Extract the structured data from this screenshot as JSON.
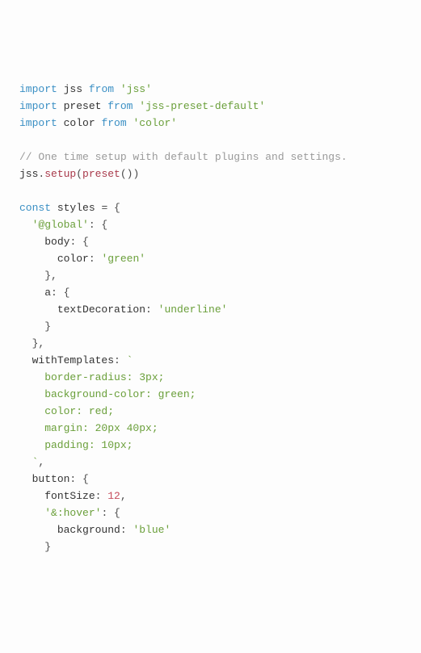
{
  "lines": [
    {
      "t": [
        {
          "c": "kw",
          "v": "import"
        },
        {
          "c": "pun",
          "v": " "
        },
        {
          "c": "id",
          "v": "jss"
        },
        {
          "c": "pun",
          "v": " "
        },
        {
          "c": "kw",
          "v": "from"
        },
        {
          "c": "pun",
          "v": " "
        },
        {
          "c": "str",
          "v": "'jss'"
        }
      ]
    },
    {
      "t": [
        {
          "c": "kw",
          "v": "import"
        },
        {
          "c": "pun",
          "v": " "
        },
        {
          "c": "id",
          "v": "preset"
        },
        {
          "c": "pun",
          "v": " "
        },
        {
          "c": "kw",
          "v": "from"
        },
        {
          "c": "pun",
          "v": " "
        },
        {
          "c": "str",
          "v": "'jss-preset-default'"
        }
      ]
    },
    {
      "t": [
        {
          "c": "kw",
          "v": "import"
        },
        {
          "c": "pun",
          "v": " "
        },
        {
          "c": "id",
          "v": "color"
        },
        {
          "c": "pun",
          "v": " "
        },
        {
          "c": "kw",
          "v": "from"
        },
        {
          "c": "pun",
          "v": " "
        },
        {
          "c": "str",
          "v": "'color'"
        }
      ]
    },
    {
      "t": [
        {
          "c": "pun",
          "v": ""
        }
      ]
    },
    {
      "t": [
        {
          "c": "cmt",
          "v": "// One time setup with default plugins and settings."
        }
      ]
    },
    {
      "t": [
        {
          "c": "id",
          "v": "jss"
        },
        {
          "c": "pun",
          "v": "."
        },
        {
          "c": "call",
          "v": "setup"
        },
        {
          "c": "pun",
          "v": "("
        },
        {
          "c": "call",
          "v": "preset"
        },
        {
          "c": "pun",
          "v": "())"
        }
      ]
    },
    {
      "t": [
        {
          "c": "pun",
          "v": ""
        }
      ]
    },
    {
      "t": [
        {
          "c": "kw",
          "v": "const"
        },
        {
          "c": "pun",
          "v": " "
        },
        {
          "c": "id",
          "v": "styles"
        },
        {
          "c": "pun",
          "v": " = {"
        }
      ]
    },
    {
      "t": [
        {
          "c": "pun",
          "v": "  "
        },
        {
          "c": "str",
          "v": "'@global'"
        },
        {
          "c": "pun",
          "v": ": {"
        }
      ]
    },
    {
      "t": [
        {
          "c": "pun",
          "v": "    "
        },
        {
          "c": "key",
          "v": "body"
        },
        {
          "c": "pun",
          "v": ": {"
        }
      ]
    },
    {
      "t": [
        {
          "c": "pun",
          "v": "      "
        },
        {
          "c": "key",
          "v": "color"
        },
        {
          "c": "pun",
          "v": ": "
        },
        {
          "c": "str",
          "v": "'green'"
        }
      ]
    },
    {
      "t": [
        {
          "c": "pun",
          "v": "    },"
        }
      ]
    },
    {
      "t": [
        {
          "c": "pun",
          "v": "    "
        },
        {
          "c": "key",
          "v": "a"
        },
        {
          "c": "pun",
          "v": ": {"
        }
      ]
    },
    {
      "t": [
        {
          "c": "pun",
          "v": "      "
        },
        {
          "c": "key",
          "v": "textDecoration"
        },
        {
          "c": "pun",
          "v": ": "
        },
        {
          "c": "str",
          "v": "'underline'"
        }
      ]
    },
    {
      "t": [
        {
          "c": "pun",
          "v": "    }"
        }
      ]
    },
    {
      "t": [
        {
          "c": "pun",
          "v": "  },"
        }
      ]
    },
    {
      "t": [
        {
          "c": "pun",
          "v": "  "
        },
        {
          "c": "key",
          "v": "withTemplates"
        },
        {
          "c": "pun",
          "v": ": "
        },
        {
          "c": "str",
          "v": "`"
        }
      ]
    },
    {
      "t": [
        {
          "c": "str",
          "v": "    border-radius: 3px;"
        }
      ]
    },
    {
      "t": [
        {
          "c": "str",
          "v": "    background-color: green;"
        }
      ]
    },
    {
      "t": [
        {
          "c": "str",
          "v": "    color: red;"
        }
      ]
    },
    {
      "t": [
        {
          "c": "str",
          "v": "    margin: 20px 40px;"
        }
      ]
    },
    {
      "t": [
        {
          "c": "str",
          "v": "    padding: 10px;"
        }
      ]
    },
    {
      "t": [
        {
          "c": "str",
          "v": "  `"
        },
        {
          "c": "pun",
          "v": ","
        }
      ]
    },
    {
      "t": [
        {
          "c": "pun",
          "v": "  "
        },
        {
          "c": "key",
          "v": "button"
        },
        {
          "c": "pun",
          "v": ": {"
        }
      ]
    },
    {
      "t": [
        {
          "c": "pun",
          "v": "    "
        },
        {
          "c": "key",
          "v": "fontSize"
        },
        {
          "c": "pun",
          "v": ": "
        },
        {
          "c": "num",
          "v": "12"
        },
        {
          "c": "pun",
          "v": ","
        }
      ]
    },
    {
      "t": [
        {
          "c": "pun",
          "v": "    "
        },
        {
          "c": "str",
          "v": "'&:hover'"
        },
        {
          "c": "pun",
          "v": ": {"
        }
      ]
    },
    {
      "t": [
        {
          "c": "pun",
          "v": "      "
        },
        {
          "c": "key",
          "v": "background"
        },
        {
          "c": "pun",
          "v": ": "
        },
        {
          "c": "str",
          "v": "'blue'"
        }
      ]
    },
    {
      "t": [
        {
          "c": "pun",
          "v": "    }"
        }
      ]
    }
  ]
}
